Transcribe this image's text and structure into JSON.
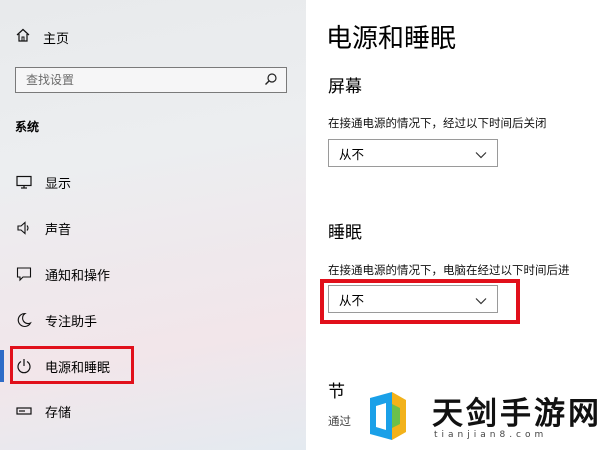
{
  "sidebar": {
    "home_label": "主页",
    "search_placeholder": "查找设置",
    "section_title": "系统",
    "items": [
      {
        "label": "显示",
        "icon": "monitor-icon"
      },
      {
        "label": "声音",
        "icon": "speaker-icon"
      },
      {
        "label": "通知和操作",
        "icon": "notification-icon"
      },
      {
        "label": "专注助手",
        "icon": "moon-icon"
      },
      {
        "label": "电源和睡眠",
        "icon": "power-icon",
        "active": true
      },
      {
        "label": "存储",
        "icon": "storage-icon"
      }
    ]
  },
  "main": {
    "title": "电源和睡眠",
    "screen": {
      "heading": "屏幕",
      "description": "在接通电源的情况下，经过以下时间后关闭",
      "value": "从不"
    },
    "sleep": {
      "heading": "睡眠",
      "description": "在接通电源的情况下，电脑在经过以下时间后进",
      "value": "从不"
    },
    "partial_heading": "节",
    "partial_description": "通过"
  },
  "watermark": {
    "title": "天剑手游网",
    "subtitle": "tianjian8.com"
  },
  "colors": {
    "highlight": "#e1101b",
    "accent": "#2f6cc7"
  }
}
